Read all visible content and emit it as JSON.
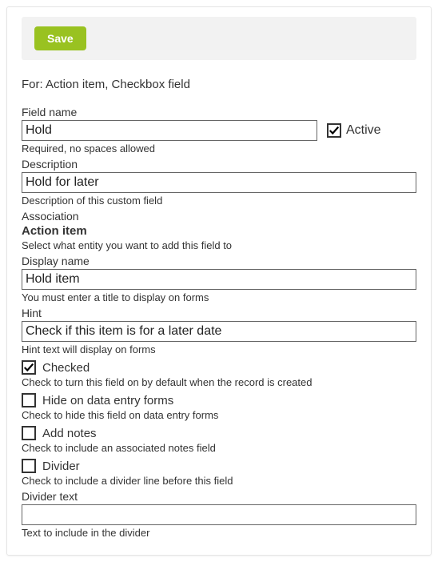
{
  "toolbar": {
    "save_label": "Save"
  },
  "for_line": "For: Action item, Checkbox field",
  "field_name": {
    "label": "Field name",
    "value": "Hold",
    "help": "Required, no spaces allowed"
  },
  "active": {
    "label": "Active",
    "checked": true
  },
  "description": {
    "label": "Description",
    "value": "Hold for later",
    "help": "Description of this custom field"
  },
  "association": {
    "label": "Association",
    "value": "Action item",
    "help": "Select what entity you want to add this field to"
  },
  "display_name": {
    "label": "Display name",
    "value": "Hold item",
    "help": "You must enter a title to display on forms"
  },
  "hint": {
    "label": "Hint",
    "value": "Check if this item is for a later date",
    "help": "Hint text will display on forms"
  },
  "checked": {
    "label": "Checked",
    "checked": true,
    "help": "Check to turn this field on by default when the record is created"
  },
  "hide_on_forms": {
    "label": "Hide on data entry forms",
    "checked": false,
    "help": "Check to hide this field on data entry forms"
  },
  "add_notes": {
    "label": "Add notes",
    "checked": false,
    "help": "Check to include an associated notes field"
  },
  "divider": {
    "label": "Divider",
    "checked": false,
    "help": "Check to include a divider line before this field"
  },
  "divider_text": {
    "label": "Divider text",
    "value": "",
    "help": "Text to include in the divider"
  }
}
